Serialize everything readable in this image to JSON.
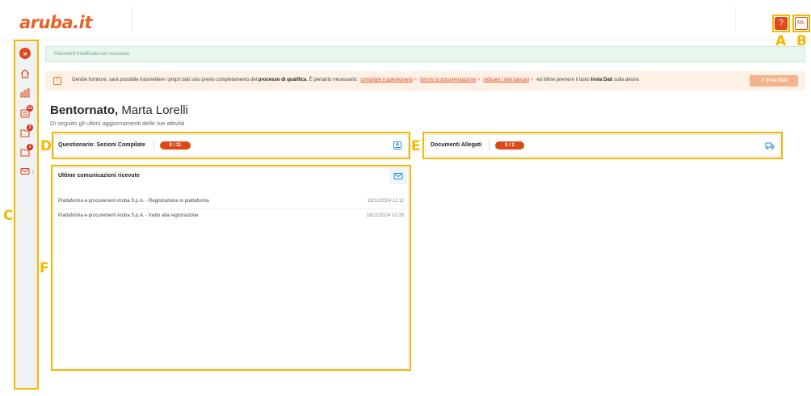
{
  "header": {
    "logo_text": "aruba.it",
    "help_label": "?",
    "user_initials": "ML"
  },
  "markers": {
    "a": "A",
    "b": "B",
    "c": "C",
    "c_inner": "C",
    "d": "D",
    "e": "E",
    "f": "F"
  },
  "sidebar": {
    "expand_label": "»",
    "items": [
      {
        "icon": "home-icon"
      },
      {
        "icon": "chart-icon"
      },
      {
        "icon": "document-list-icon",
        "badge": "11"
      },
      {
        "icon": "folder-icon",
        "badge": "2"
      },
      {
        "icon": "folder-alert-icon",
        "badge": "1"
      },
      {
        "icon": "mail-icon"
      }
    ],
    "chevron": "›"
  },
  "alerts": {
    "success_text": "Password modificata con successo"
  },
  "notice": {
    "icon": "!",
    "text_1": "Gentile fornitore, sarà possibile trasmettere i propri dati solo previo completamento del",
    "bold_1": "processo di qualifica",
    "text_2": ". È pertanto necessario:",
    "link_1": "compilare il questionario",
    "link_2": "fornire la documentazione",
    "link_3": "indicare i dati bancari",
    "text_3": "ed infine premere il tasto",
    "bold_2": "Invia Dati",
    "text_4": "sulla destra",
    "send_button": "Invia Dati"
  },
  "welcome": {
    "greeting": "Bentornato,",
    "name": "Marta Lorelli",
    "subtitle": "Di seguito gli ultimi aggiornamenti delle tue attività"
  },
  "cards": {
    "questionnaire": {
      "title": "Questionario: Sezioni Compilate",
      "badge": "0 / 11"
    },
    "documents": {
      "title": "Documenti Allegati",
      "badge": "0 / 2"
    },
    "communications": {
      "title": "Ultime comunicazioni ricevute",
      "rows": [
        {
          "text": "Piattaforma e-procurement Aruba S.p.A. - Registrazione in piattaforma",
          "date": "18/11/2024 11:11"
        },
        {
          "text": "Piattaforma e-procurement Aruba S.p.A. - Invito alla registrazione",
          "date": "18/11/2024 10:28"
        }
      ]
    }
  },
  "colors": {
    "brand": "#e0491a",
    "marker": "#f5b800"
  }
}
